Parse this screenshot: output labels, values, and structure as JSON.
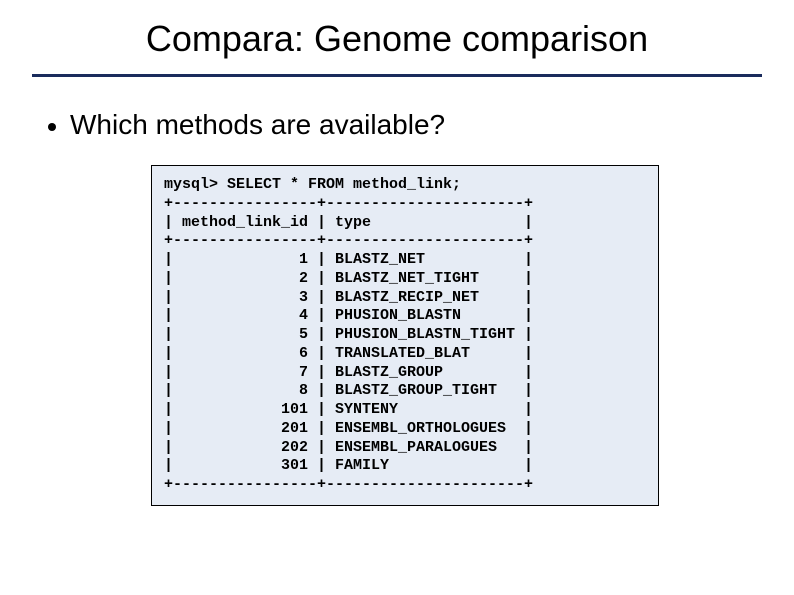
{
  "slide": {
    "title": "Compara: Genome comparison",
    "bullet": "Which methods are available?"
  },
  "terminal": {
    "prompt_line": "mysql> SELECT * FROM method_link;",
    "border_line": "+----------------+----------------------+",
    "header_line": "| method_link_id | type                 |",
    "rows": [
      "|              1 | BLASTZ_NET           |",
      "|              2 | BLASTZ_NET_TIGHT     |",
      "|              3 | BLASTZ_RECIP_NET     |",
      "|              4 | PHUSION_BLASTN       |",
      "|              5 | PHUSION_BLASTN_TIGHT |",
      "|              6 | TRANSLATED_BLAT      |",
      "|              7 | BLASTZ_GROUP         |",
      "|              8 | BLASTZ_GROUP_TIGHT   |",
      "|            101 | SYNTENY              |",
      "|            201 | ENSEMBL_ORTHOLOGUES  |",
      "|            202 | ENSEMBL_PARALOGUES   |",
      "|            301 | FAMILY               |"
    ]
  },
  "chart_data": {
    "type": "table",
    "title": "method_link",
    "query": "SELECT * FROM method_link;",
    "columns": [
      "method_link_id",
      "type"
    ],
    "rows": [
      {
        "method_link_id": 1,
        "type": "BLASTZ_NET"
      },
      {
        "method_link_id": 2,
        "type": "BLASTZ_NET_TIGHT"
      },
      {
        "method_link_id": 3,
        "type": "BLASTZ_RECIP_NET"
      },
      {
        "method_link_id": 4,
        "type": "PHUSION_BLASTN"
      },
      {
        "method_link_id": 5,
        "type": "PHUSION_BLASTN_TIGHT"
      },
      {
        "method_link_id": 6,
        "type": "TRANSLATED_BLAT"
      },
      {
        "method_link_id": 7,
        "type": "BLASTZ_GROUP"
      },
      {
        "method_link_id": 8,
        "type": "BLASTZ_GROUP_TIGHT"
      },
      {
        "method_link_id": 101,
        "type": "SYNTENY"
      },
      {
        "method_link_id": 201,
        "type": "ENSEMBL_ORTHOLOGUES"
      },
      {
        "method_link_id": 202,
        "type": "ENSEMBL_PARALOGUES"
      },
      {
        "method_link_id": 301,
        "type": "FAMILY"
      }
    ]
  }
}
